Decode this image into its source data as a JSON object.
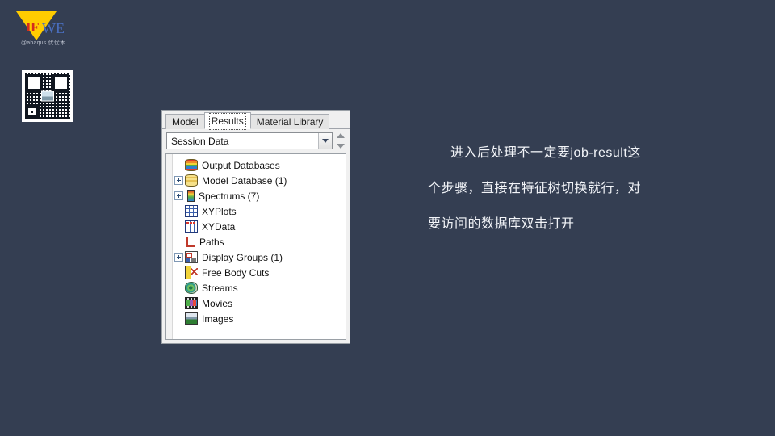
{
  "background_color": "#343e52",
  "logo": {
    "mark_if": "IF",
    "mark_we": "WE",
    "subtitle": "@abaqus 优优木",
    "triangle_color": "#ffcc00",
    "if_color": "#d42b1e",
    "we_color": "#4a6fc0"
  },
  "qr_code": {
    "name": "qr-code"
  },
  "tree_panel": {
    "tabs": [
      {
        "label": "Model",
        "selected": false
      },
      {
        "label": "Results",
        "selected": true
      },
      {
        "label": "Material Library",
        "selected": false
      }
    ],
    "combo": {
      "value": "Session Data",
      "arrow_icon": "chevron-down-icon",
      "spinner_up_icon": "triangle-up-icon",
      "spinner_down_icon": "triangle-down-icon"
    },
    "tree_items": [
      {
        "label": "Output Databases",
        "icon": "output-database-icon",
        "expandable": false
      },
      {
        "label": "Model Database (1)",
        "icon": "model-database-icon",
        "expandable": true
      },
      {
        "label": "Spectrums (7)",
        "icon": "spectrum-icon",
        "expandable": true
      },
      {
        "label": "XYPlots",
        "icon": "xy-plot-icon",
        "expandable": false
      },
      {
        "label": "XYData",
        "icon": "xy-data-icon",
        "expandable": false
      },
      {
        "label": "Paths",
        "icon": "path-icon",
        "expandable": false
      },
      {
        "label": "Display Groups (1)",
        "icon": "display-group-icon",
        "expandable": true
      },
      {
        "label": "Free Body Cuts",
        "icon": "free-body-cut-icon",
        "expandable": false
      },
      {
        "label": "Streams",
        "icon": "stream-icon",
        "expandable": false
      },
      {
        "label": "Movies",
        "icon": "movie-icon",
        "expandable": false
      },
      {
        "label": "Images",
        "icon": "image-icon",
        "expandable": false
      }
    ]
  },
  "caption": {
    "line1": "进入后处理不一定要job-result这",
    "line2": "个步骤，直接在特征树切换就行，对",
    "line3": "要访问的数据库双击打开",
    "text_color": "#f2f4f8"
  }
}
